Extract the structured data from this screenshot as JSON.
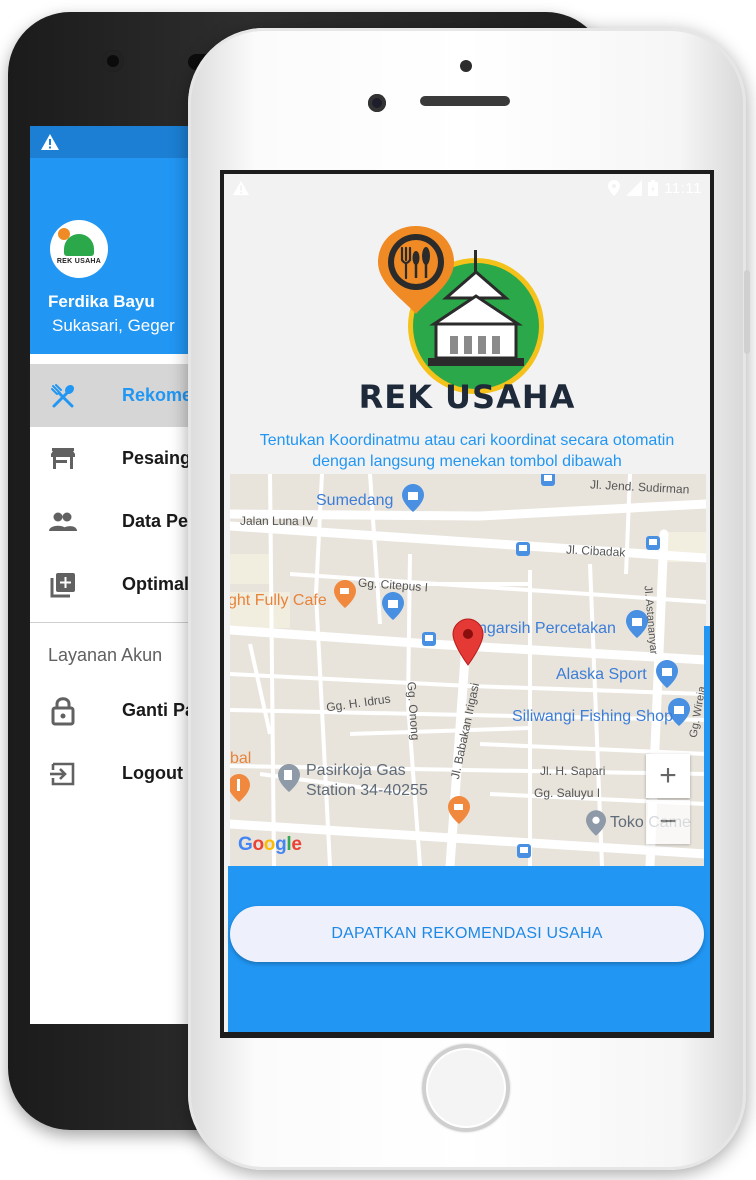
{
  "back_phone": {
    "user_name": "Ferdika Bayu",
    "user_address": "Sukasari, Geger",
    "avatar_logo_text": "REK USAHA",
    "menu": [
      {
        "label": "Rekome",
        "icon": "restaurant-icon",
        "active": true
      },
      {
        "label": "Pesaing",
        "icon": "store-icon",
        "active": false
      },
      {
        "label": "Data Pe",
        "icon": "people-icon",
        "active": false
      },
      {
        "label": "Optimal",
        "icon": "library-add-icon",
        "active": false
      }
    ],
    "section_title": "Layanan Akun",
    "account_menu": [
      {
        "label": "Ganti Pa",
        "icon": "lock-icon"
      },
      {
        "label": "Logout",
        "icon": "logout-icon"
      }
    ]
  },
  "front_phone": {
    "status_time": "11:11",
    "logo_title": "REK USAHA",
    "instruction_line1": "Tentukan Koordinatmu atau cari koordinat secara otomatin",
    "instruction_line2": "dengan langsung menekan tombol dibawah",
    "cta_label": "DAPATKAN REKOMENDASI USAHA",
    "map": {
      "attribution": "Google",
      "zoom_in": "+",
      "zoom_out": "−",
      "street_labels": {
        "jalan_luna": "Jalan Luna IV",
        "jend_sudirman": "Jl. Jend. Sudirman",
        "cibadak": "Jl. Cibadak",
        "citepus": "Gg. Citepus I",
        "astananyar": "Jl. Astananyar",
        "wireja": "Gg. Wireja",
        "h_idrus": "Gg. H. Idrus",
        "onong": "Gg. Onong",
        "babakan": "Jl. Babakan Irigasi",
        "h_sapari": "Jl. H. Sapari",
        "saluyu": "Gg. Saluyu I"
      },
      "poi_labels": {
        "sumedang": "Sumedang",
        "cafe": "ght Fully Cafe",
        "percetakan": "ngarsih Percetakan",
        "alaska": "Alaska Sport",
        "siliwangi": "Siliwangi Fishing Shop",
        "pasirkoja1": "Pasirkoja Gas",
        "pasirkoja2": "Station 34-40255",
        "bal": "bal",
        "toko": "Toko Came"
      }
    }
  },
  "colors": {
    "primary": "#2196f3",
    "status_bar": "#1c7fd4",
    "cta_text": "#1e88e5",
    "marker": "#e53935",
    "logo_orange": "#f08a24",
    "logo_green": "#2aa84a",
    "logo_yellow": "#f4c21b"
  }
}
